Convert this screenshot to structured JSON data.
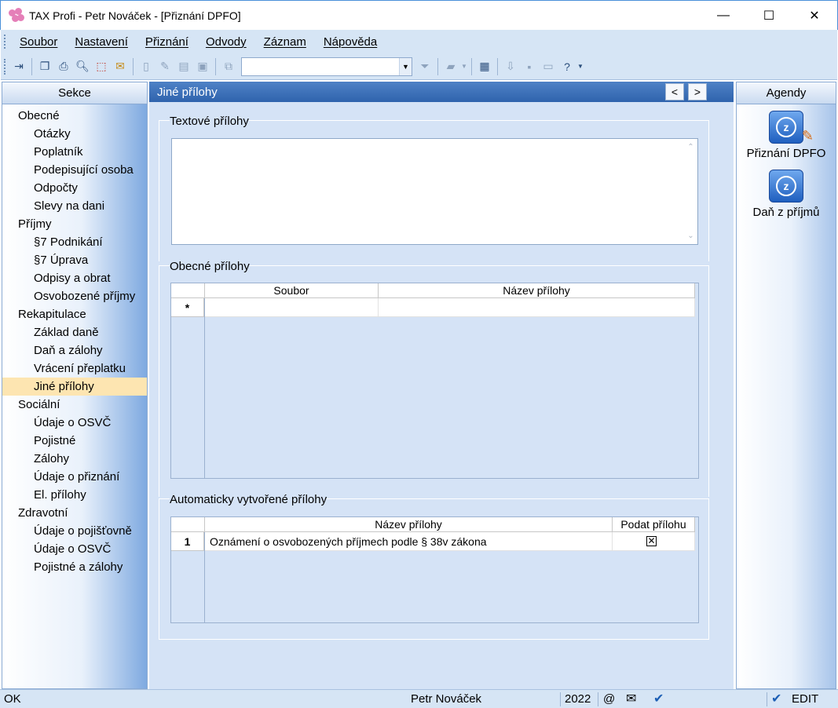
{
  "window": {
    "title": "TAX Profi - Petr Nováček - [Přiznání DPFO]",
    "minimize": "—",
    "maximize": "☐",
    "close": "✕"
  },
  "menu": [
    "Soubor",
    "Nastavení",
    "Přiznání",
    "Odvody",
    "Záznam",
    "Nápověda"
  ],
  "toolbar": {
    "combo_value": ""
  },
  "sidebar": {
    "header": "Sekce",
    "items": [
      {
        "label": "Obecné",
        "level": "group"
      },
      {
        "label": "Otázky",
        "level": "sub"
      },
      {
        "label": "Poplatník",
        "level": "sub"
      },
      {
        "label": "Podepisující osoba",
        "level": "sub"
      },
      {
        "label": "Odpočty",
        "level": "sub"
      },
      {
        "label": "Slevy na dani",
        "level": "sub"
      },
      {
        "label": "Příjmy",
        "level": "group"
      },
      {
        "label": "§7 Podnikání",
        "level": "sub"
      },
      {
        "label": "§7 Úprava",
        "level": "sub"
      },
      {
        "label": "Odpisy a obrat",
        "level": "sub"
      },
      {
        "label": "Osvobozené příjmy",
        "level": "sub"
      },
      {
        "label": "Rekapitulace",
        "level": "group"
      },
      {
        "label": "Základ daně",
        "level": "sub"
      },
      {
        "label": "Daň a zálohy",
        "level": "sub"
      },
      {
        "label": "Vrácení přeplatku",
        "level": "sub"
      },
      {
        "label": "Jiné přílohy",
        "level": "sub",
        "active": true
      },
      {
        "label": "Sociální",
        "level": "group"
      },
      {
        "label": "Údaje o OSVČ",
        "level": "sub"
      },
      {
        "label": "Pojistné",
        "level": "sub"
      },
      {
        "label": "Zálohy",
        "level": "sub"
      },
      {
        "label": "Údaje o přiznání",
        "level": "sub"
      },
      {
        "label": "El. přílohy",
        "level": "sub"
      },
      {
        "label": "Zdravotní",
        "level": "group"
      },
      {
        "label": "Údaje o pojišťovně",
        "level": "sub"
      },
      {
        "label": "Údaje o OSVČ",
        "level": "sub"
      },
      {
        "label": "Pojistné a zálohy",
        "level": "sub"
      }
    ]
  },
  "main": {
    "title": "Jiné přílohy",
    "prev": "<",
    "next": ">",
    "text_section": {
      "legend": "Textové přílohy",
      "value": "",
      "scroll_up": "⌃",
      "scroll_down": "⌄"
    },
    "general_section": {
      "legend": "Obecné přílohy",
      "columns": [
        "Soubor",
        "Název přílohy"
      ],
      "new_row_marker": "*"
    },
    "auto_section": {
      "legend": "Automaticky vytvořené přílohy",
      "columns": [
        "Název přílohy",
        "Podat přílohu"
      ],
      "rows": [
        {
          "index": "1",
          "name": "Oznámení o osvobozených příjmech podle § 38v zákona",
          "checked": "✕"
        }
      ]
    }
  },
  "agendy": {
    "header": "Agendy",
    "items": [
      {
        "label": "Přiznání DPFO",
        "icon": "tax-declaration-icon"
      },
      {
        "label": "Daň z příjmů",
        "icon": "income-tax-icon"
      }
    ]
  },
  "statusbar": {
    "state": "OK",
    "user": "Petr Nováček",
    "year": "2022",
    "at": "@",
    "mode": "EDIT"
  },
  "colors": {
    "header_blue": "#2f63ad",
    "panel_bg": "#d5e3f6",
    "active_item": "#fde5b1"
  }
}
